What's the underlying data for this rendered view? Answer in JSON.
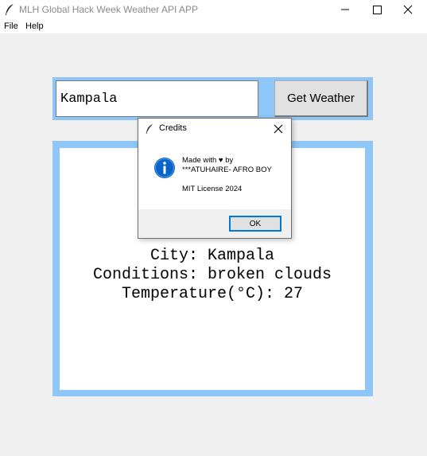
{
  "window": {
    "title": "MLH Global Hack Week Weather API APP"
  },
  "menu": {
    "items": [
      "File",
      "Help"
    ]
  },
  "search": {
    "city_value": "Kampala",
    "button_label": "Get Weather"
  },
  "weather": {
    "city_line": "City: Kampala",
    "conditions_line": "Conditions: broken clouds",
    "temperature_line": "Temperature(°C): 27"
  },
  "dialog": {
    "title": "Credits",
    "line1": "Made with ♥ by",
    "line2": "***ATUHAIRE- AFRO BOY",
    "license": "MIT License 2024",
    "ok_label": "OK"
  },
  "icons": {
    "app": "feather-icon",
    "minimize": "minimize-icon",
    "maximize": "maximize-icon",
    "close": "close-icon",
    "info": "info-icon"
  },
  "colors": {
    "frame_accent": "#8ec6f7",
    "info_blue": "#0a64c8",
    "dialog_focus": "#0078d7"
  }
}
